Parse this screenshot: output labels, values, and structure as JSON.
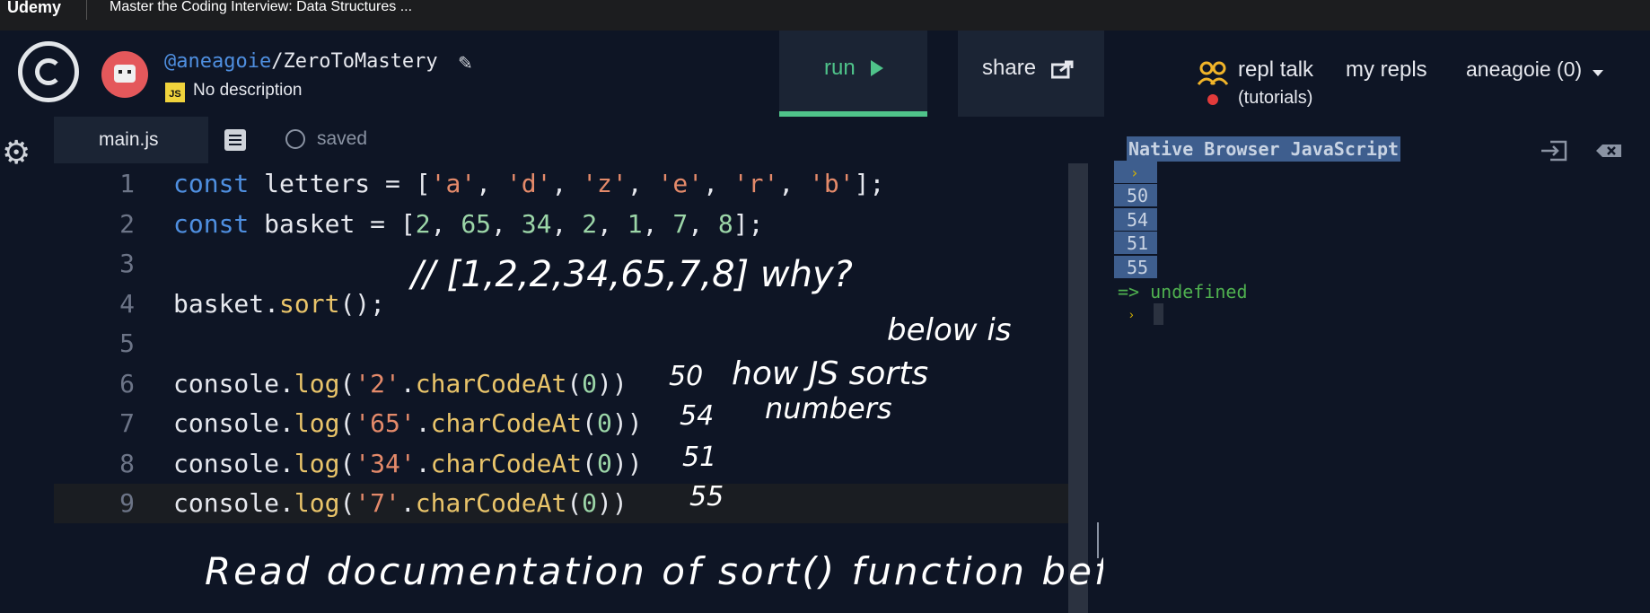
{
  "browser": {
    "brand": "Udemy",
    "course_title": "Master the Coding Interview: Data Structures ..."
  },
  "repl": {
    "owner": "@aneagoie",
    "separator": "/",
    "name": "ZeroToMastery",
    "language_badge": "JS",
    "description": "No description"
  },
  "toolbar": {
    "run_label": "run",
    "share_label": "share"
  },
  "nav": {
    "repl_talk": "repl talk",
    "tutorials": "(tutorials)",
    "my_repls": "my repls",
    "user": "aneagoie (0)"
  },
  "tabs": {
    "file": "main.js",
    "status": "saved"
  },
  "code_lines": [
    {
      "n": "1",
      "tokens": [
        [
          "kw",
          "const"
        ],
        [
          "plain",
          " letters = ["
        ],
        [
          "str",
          "'a'"
        ],
        [
          "plain",
          ", "
        ],
        [
          "str",
          "'d'"
        ],
        [
          "plain",
          ", "
        ],
        [
          "str",
          "'z'"
        ],
        [
          "plain",
          ", "
        ],
        [
          "str",
          "'e'"
        ],
        [
          "plain",
          ", "
        ],
        [
          "str",
          "'r'"
        ],
        [
          "plain",
          ", "
        ],
        [
          "str",
          "'b'"
        ],
        [
          "plain",
          "];"
        ]
      ]
    },
    {
      "n": "2",
      "tokens": [
        [
          "kw",
          "const"
        ],
        [
          "plain",
          " basket = ["
        ],
        [
          "num",
          "2"
        ],
        [
          "plain",
          ", "
        ],
        [
          "num",
          "65"
        ],
        [
          "plain",
          ", "
        ],
        [
          "num",
          "34"
        ],
        [
          "plain",
          ", "
        ],
        [
          "num",
          "2"
        ],
        [
          "plain",
          ", "
        ],
        [
          "num",
          "1"
        ],
        [
          "plain",
          ", "
        ],
        [
          "num",
          "7"
        ],
        [
          "plain",
          ", "
        ],
        [
          "num",
          "8"
        ],
        [
          "plain",
          "];"
        ]
      ]
    },
    {
      "n": "3",
      "tokens": []
    },
    {
      "n": "4",
      "tokens": [
        [
          "plain",
          "basket."
        ],
        [
          "fn",
          "sort"
        ],
        [
          "plain",
          "();"
        ]
      ]
    },
    {
      "n": "5",
      "tokens": []
    },
    {
      "n": "6",
      "tokens": [
        [
          "plain",
          "console."
        ],
        [
          "fn",
          "log"
        ],
        [
          "plain",
          "("
        ],
        [
          "str",
          "'2'"
        ],
        [
          "plain",
          "."
        ],
        [
          "fn",
          "charCodeAt"
        ],
        [
          "plain",
          "("
        ],
        [
          "num",
          "0"
        ],
        [
          "plain",
          "))"
        ]
      ]
    },
    {
      "n": "7",
      "tokens": [
        [
          "plain",
          "console."
        ],
        [
          "fn",
          "log"
        ],
        [
          "plain",
          "("
        ],
        [
          "str",
          "'65'"
        ],
        [
          "plain",
          "."
        ],
        [
          "fn",
          "charCodeAt"
        ],
        [
          "plain",
          "("
        ],
        [
          "num",
          "0"
        ],
        [
          "plain",
          "))"
        ]
      ]
    },
    {
      "n": "8",
      "tokens": [
        [
          "plain",
          "console."
        ],
        [
          "fn",
          "log"
        ],
        [
          "plain",
          "("
        ],
        [
          "str",
          "'34'"
        ],
        [
          "plain",
          "."
        ],
        [
          "fn",
          "charCodeAt"
        ],
        [
          "plain",
          "("
        ],
        [
          "num",
          "0"
        ],
        [
          "plain",
          "))"
        ]
      ]
    },
    {
      "n": "9",
      "tokens": [
        [
          "plain",
          "console."
        ],
        [
          "fn",
          "log"
        ],
        [
          "plain",
          "("
        ],
        [
          "str",
          "'7'"
        ],
        [
          "plain",
          "."
        ],
        [
          "fn",
          "charCodeAt"
        ],
        [
          "plain",
          "("
        ],
        [
          "num",
          "0"
        ],
        [
          "plain",
          "))"
        ]
      ]
    }
  ],
  "annotations": {
    "sort_result": "// [1,2,2,34,65,7,8] why?",
    "below_is": "below is",
    "how_js_sorts": "how JS sorts",
    "numbers": "numbers",
    "v50": "50",
    "v54": "54",
    "v51": "51",
    "v55": "55",
    "footer_note": "Read documentation of sort() function before using"
  },
  "console": {
    "header": "Native Browser JavaScript",
    "prompt_glyph": "›",
    "outputs": [
      "50",
      "54",
      "51",
      "55"
    ],
    "result": "=> undefined"
  },
  "colors": {
    "accent_green": "#4fc38a",
    "keyword": "#4f8fe0",
    "string": "#e48a6a",
    "number": "#9cd6a8",
    "function": "#e9c46a"
  }
}
